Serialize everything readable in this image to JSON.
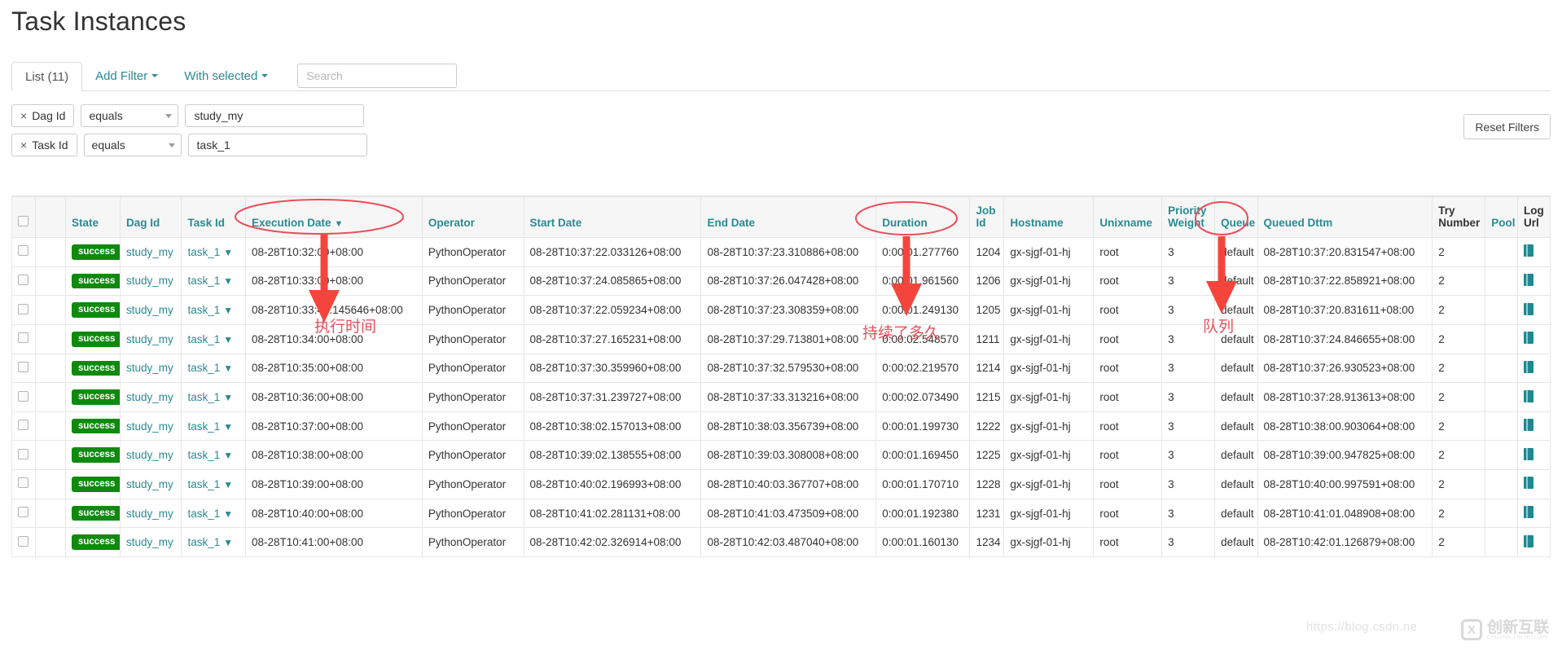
{
  "page_title": "Task Instances",
  "toolbar": {
    "list_tab": "List (11)",
    "add_filter": "Add Filter",
    "with_selected": "With selected",
    "search_placeholder": "Search",
    "reset_filters": "Reset Filters"
  },
  "filters": [
    {
      "chip_x": "×",
      "chip_label": "Dag Id",
      "operator": "equals",
      "value": "study_my"
    },
    {
      "chip_x": "×",
      "chip_label": "Task Id",
      "operator": "equals",
      "value": "task_1"
    }
  ],
  "columns": [
    {
      "key": "checkbox",
      "label": "",
      "link": false
    },
    {
      "key": "actions",
      "label": "",
      "link": false
    },
    {
      "key": "state",
      "label": "State",
      "link": true
    },
    {
      "key": "dag_id",
      "label": "Dag Id",
      "link": true
    },
    {
      "key": "task_id",
      "label": "Task Id",
      "link": true
    },
    {
      "key": "execution_date",
      "label": "Execution Date",
      "link": true,
      "sorted": "▼"
    },
    {
      "key": "operator",
      "label": "Operator",
      "link": true
    },
    {
      "key": "start_date",
      "label": "Start Date",
      "link": true
    },
    {
      "key": "end_date",
      "label": "End Date",
      "link": true
    },
    {
      "key": "duration",
      "label": "Duration",
      "link": true
    },
    {
      "key": "job_id",
      "label": "Job Id",
      "link": true
    },
    {
      "key": "hostname",
      "label": "Hostname",
      "link": true
    },
    {
      "key": "unixname",
      "label": "Unixname",
      "link": true
    },
    {
      "key": "priority_weight",
      "label": "Priority Weight",
      "link": true
    },
    {
      "key": "queue",
      "label": "Queue",
      "link": true
    },
    {
      "key": "queued_dttm",
      "label": "Queued Dttm",
      "link": true
    },
    {
      "key": "try_number",
      "label": "Try Number",
      "link": false
    },
    {
      "key": "pool",
      "label": "Pool",
      "link": true
    },
    {
      "key": "log_url",
      "label": "Log Url",
      "link": false
    }
  ],
  "state_label": "success",
  "rows": [
    {
      "state": "success",
      "dag_id": "study_my",
      "task_id": "task_1",
      "execution_date": "08-28T10:32:00+08:00",
      "operator": "PythonOperator",
      "start_date": "08-28T10:37:22.033126+08:00",
      "end_date": "08-28T10:37:23.310886+08:00",
      "duration": "0:00:01.277760",
      "job_id": "1204",
      "hostname": "gx-sjgf-01-hj",
      "unixname": "root",
      "priority_weight": "3",
      "queue": "default",
      "queued_dttm": "08-28T10:37:20.831547+08:00",
      "try_number": "2",
      "pool": ""
    },
    {
      "state": "success",
      "dag_id": "study_my",
      "task_id": "task_1",
      "execution_date": "08-28T10:33:00+08:00",
      "operator": "PythonOperator",
      "start_date": "08-28T10:37:24.085865+08:00",
      "end_date": "08-28T10:37:26.047428+08:00",
      "duration": "0:00:01.961560",
      "job_id": "1206",
      "hostname": "gx-sjgf-01-hj",
      "unixname": "root",
      "priority_weight": "3",
      "queue": "default",
      "queued_dttm": "08-28T10:37:22.858921+08:00",
      "try_number": "2",
      "pool": ""
    },
    {
      "state": "success",
      "dag_id": "study_my",
      "task_id": "task_1",
      "execution_date": "08-28T10:33:46.145646+08:00",
      "operator": "PythonOperator",
      "start_date": "08-28T10:37:22.059234+08:00",
      "end_date": "08-28T10:37:23.308359+08:00",
      "duration": "0:00:01.249130",
      "job_id": "1205",
      "hostname": "gx-sjgf-01-hj",
      "unixname": "root",
      "priority_weight": "3",
      "queue": "default",
      "queued_dttm": "08-28T10:37:20.831611+08:00",
      "try_number": "2",
      "pool": ""
    },
    {
      "state": "success",
      "dag_id": "study_my",
      "task_id": "task_1",
      "execution_date": "08-28T10:34:00+08:00",
      "operator": "PythonOperator",
      "start_date": "08-28T10:37:27.165231+08:00",
      "end_date": "08-28T10:37:29.713801+08:00",
      "duration": "0:00:02.548570",
      "job_id": "1211",
      "hostname": "gx-sjgf-01-hj",
      "unixname": "root",
      "priority_weight": "3",
      "queue": "default",
      "queued_dttm": "08-28T10:37:24.846655+08:00",
      "try_number": "2",
      "pool": ""
    },
    {
      "state": "success",
      "dag_id": "study_my",
      "task_id": "task_1",
      "execution_date": "08-28T10:35:00+08:00",
      "operator": "PythonOperator",
      "start_date": "08-28T10:37:30.359960+08:00",
      "end_date": "08-28T10:37:32.579530+08:00",
      "duration": "0:00:02.219570",
      "job_id": "1214",
      "hostname": "gx-sjgf-01-hj",
      "unixname": "root",
      "priority_weight": "3",
      "queue": "default",
      "queued_dttm": "08-28T10:37:26.930523+08:00",
      "try_number": "2",
      "pool": ""
    },
    {
      "state": "success",
      "dag_id": "study_my",
      "task_id": "task_1",
      "execution_date": "08-28T10:36:00+08:00",
      "operator": "PythonOperator",
      "start_date": "08-28T10:37:31.239727+08:00",
      "end_date": "08-28T10:37:33.313216+08:00",
      "duration": "0:00:02.073490",
      "job_id": "1215",
      "hostname": "gx-sjgf-01-hj",
      "unixname": "root",
      "priority_weight": "3",
      "queue": "default",
      "queued_dttm": "08-28T10:37:28.913613+08:00",
      "try_number": "2",
      "pool": ""
    },
    {
      "state": "success",
      "dag_id": "study_my",
      "task_id": "task_1",
      "execution_date": "08-28T10:37:00+08:00",
      "operator": "PythonOperator",
      "start_date": "08-28T10:38:02.157013+08:00",
      "end_date": "08-28T10:38:03.356739+08:00",
      "duration": "0:00:01.199730",
      "job_id": "1222",
      "hostname": "gx-sjgf-01-hj",
      "unixname": "root",
      "priority_weight": "3",
      "queue": "default",
      "queued_dttm": "08-28T10:38:00.903064+08:00",
      "try_number": "2",
      "pool": ""
    },
    {
      "state": "success",
      "dag_id": "study_my",
      "task_id": "task_1",
      "execution_date": "08-28T10:38:00+08:00",
      "operator": "PythonOperator",
      "start_date": "08-28T10:39:02.138555+08:00",
      "end_date": "08-28T10:39:03.308008+08:00",
      "duration": "0:00:01.169450",
      "job_id": "1225",
      "hostname": "gx-sjgf-01-hj",
      "unixname": "root",
      "priority_weight": "3",
      "queue": "default",
      "queued_dttm": "08-28T10:39:00.947825+08:00",
      "try_number": "2",
      "pool": ""
    },
    {
      "state": "success",
      "dag_id": "study_my",
      "task_id": "task_1",
      "execution_date": "08-28T10:39:00+08:00",
      "operator": "PythonOperator",
      "start_date": "08-28T10:40:02.196993+08:00",
      "end_date": "08-28T10:40:03.367707+08:00",
      "duration": "0:00:01.170710",
      "job_id": "1228",
      "hostname": "gx-sjgf-01-hj",
      "unixname": "root",
      "priority_weight": "3",
      "queue": "default",
      "queued_dttm": "08-28T10:40:00.997591+08:00",
      "try_number": "2",
      "pool": ""
    },
    {
      "state": "success",
      "dag_id": "study_my",
      "task_id": "task_1",
      "execution_date": "08-28T10:40:00+08:00",
      "operator": "PythonOperator",
      "start_date": "08-28T10:41:02.281131+08:00",
      "end_date": "08-28T10:41:03.473509+08:00",
      "duration": "0:00:01.192380",
      "job_id": "1231",
      "hostname": "gx-sjgf-01-hj",
      "unixname": "root",
      "priority_weight": "3",
      "queue": "default",
      "queued_dttm": "08-28T10:41:01.048908+08:00",
      "try_number": "2",
      "pool": ""
    },
    {
      "state": "success",
      "dag_id": "study_my",
      "task_id": "task_1",
      "execution_date": "08-28T10:41:00+08:00",
      "operator": "PythonOperator",
      "start_date": "08-28T10:42:02.326914+08:00",
      "end_date": "08-28T10:42:03.487040+08:00",
      "duration": "0:00:01.160130",
      "job_id": "1234",
      "hostname": "gx-sjgf-01-hj",
      "unixname": "root",
      "priority_weight": "3",
      "queue": "default",
      "queued_dttm": "08-28T10:42:01.126879+08:00",
      "try_number": "2",
      "pool": ""
    }
  ],
  "annotations": {
    "execution_time": "执行时间",
    "duration_note": "持续了多久",
    "queue_note": "队列",
    "color": "#e8505b"
  },
  "watermark": {
    "url": "https://blog.csdn.ne",
    "brand_cn": "创新互联",
    "brand_py": "CHUANG XIN HU LIAN",
    "mark": "X"
  },
  "colors": {
    "link": "#2a8a93",
    "success": "#0f8a0f",
    "annotation": "#e8505b"
  }
}
